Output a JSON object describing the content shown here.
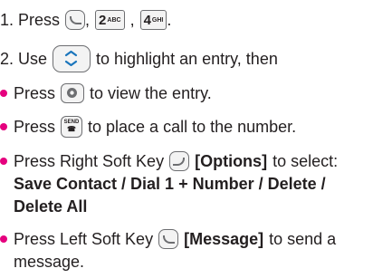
{
  "step1": {
    "prefix": "1. Press",
    "comma1": ",",
    "key2": {
      "digit": "2",
      "letters": "ABC"
    },
    "comma2": ",",
    "key4": {
      "digit": "4",
      "letters": "GHI"
    },
    "period": "."
  },
  "step2": {
    "prefix": "2. Use",
    "suffix": "to highlight an entry, then"
  },
  "bullets": {
    "view": {
      "prefix": "Press",
      "suffix": "to view the entry."
    },
    "call": {
      "prefix": "Press",
      "suffix": "to place a call to the number.",
      "key_label_top": "SEND",
      "key_label_bottom": "☎"
    },
    "options": {
      "prefix": "Press Right Soft Key",
      "bracket": "[Options]",
      "suffix": "to select:",
      "line2": "Save Contact / Dial 1 + Number / Delete /",
      "line3": "Delete All"
    },
    "message": {
      "prefix": "Press Left Soft Key",
      "bracket": "[Message]",
      "suffix": "to send a",
      "line2": "message."
    }
  },
  "colors": {
    "bullet": "#e5007e",
    "text": "#231f20",
    "key_border": "#6d6e71"
  },
  "icons": [
    "left-soft-key-icon",
    "key-2-abc-icon",
    "key-4-ghi-icon",
    "navigation-key-icon",
    "ok-key-icon",
    "send-key-icon",
    "right-soft-key-icon"
  ]
}
